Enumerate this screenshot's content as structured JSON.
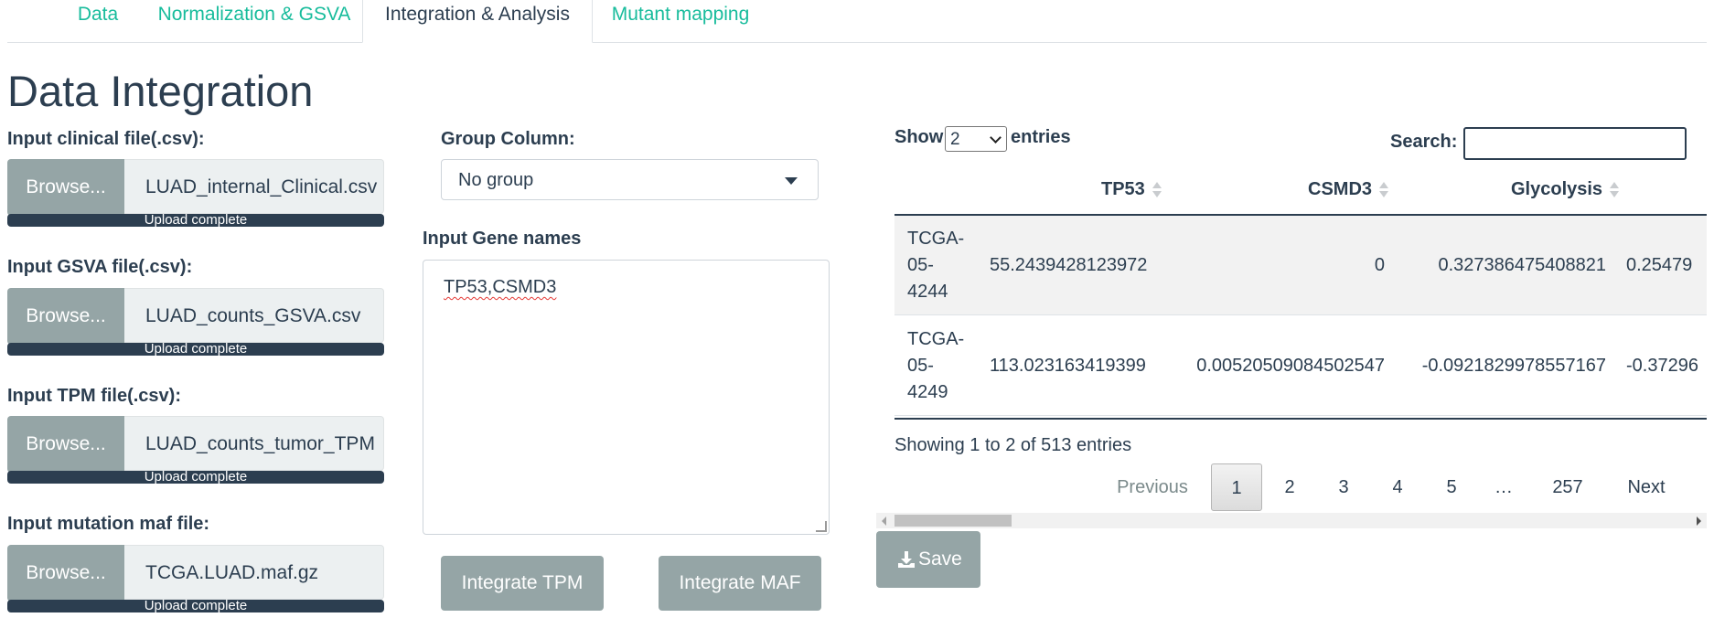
{
  "tabs": [
    "Data",
    "Normalization & GSVA",
    "Integration & Analysis",
    "Mutant mapping"
  ],
  "active_tab": "Integration & Analysis",
  "page_title": "Data Integration",
  "file_inputs": [
    {
      "label": "Input clinical file(.csv):",
      "browse": "Browse...",
      "filename": "LUAD_internal_Clinical.csv",
      "progress_text": "Upload complete",
      "progress": 1.0
    },
    {
      "label": "Input GSVA file(.csv):",
      "browse": "Browse...",
      "filename": "LUAD_counts_GSVA.csv",
      "progress_text": "Upload complete",
      "progress": 1.0
    },
    {
      "label": "Input TPM file(.csv):",
      "browse": "Browse...",
      "filename": "LUAD_counts_tumor_TPM",
      "progress_text": "Upload complete",
      "progress": 1.0
    },
    {
      "label": "Input mutation maf file:",
      "browse": "Browse...",
      "filename": "TCGA.LUAD.maf.gz",
      "progress_text": "Upload complete",
      "progress": 1.0
    }
  ],
  "group_column": {
    "label": "Group Column:",
    "value": "No group"
  },
  "gene_names": {
    "label": "Input Gene names",
    "value": "TP53,CSMD3"
  },
  "buttons": {
    "integrate_tpm": "Integrate TPM",
    "integrate_maf": "Integrate MAF",
    "save": "Save"
  },
  "table": {
    "show_label": "Show",
    "entries_label": "entries",
    "page_length": "2",
    "search_label": "Search:",
    "search_value": "",
    "columns": [
      "",
      "TP53",
      "CSMD3",
      "Glycolysis"
    ],
    "rows": [
      {
        "id": "TCGA-05-4244",
        "id_lines": [
          "TCGA-",
          "05-",
          "4244"
        ],
        "tp53": "55.2439428123972",
        "csmd3": "0",
        "glycolysis": "0.327386475408821",
        "extra": "0.25479"
      },
      {
        "id": "TCGA-05-4249",
        "id_lines": [
          "TCGA-",
          "05-",
          "4249"
        ],
        "tp53": "113.023163419399",
        "csmd3": "0.00520509084502547",
        "glycolysis": "-0.0921829978557167",
        "extra": "-0.37296"
      }
    ],
    "info": "Showing 1 to 2 of 513 entries",
    "pagination": {
      "previous": "Previous",
      "pages": [
        "1",
        "2",
        "3",
        "4",
        "5",
        "…",
        "257"
      ],
      "active": "1",
      "next": "Next"
    }
  },
  "colors": {
    "accent": "#18bc9c",
    "primary": "#2c3e50",
    "button": "#95a5a6",
    "input_bg": "#ecf0f1"
  }
}
